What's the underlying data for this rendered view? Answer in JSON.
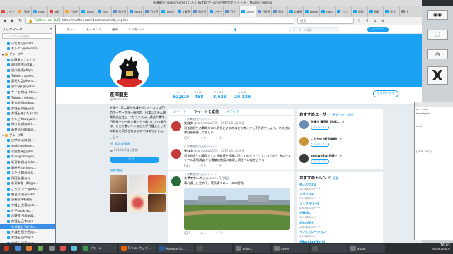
{
  "window": {
    "title": "茶澤龍史(@docmemo) さん / Twitterからの@会者指定ツイート - Mozilla Firefox"
  },
  "tabs": [
    {
      "label": "ツイー",
      "color": "#e24f3a"
    },
    {
      "label": "「仮名元",
      "color": "#f2a33a"
    },
    {
      "label": "Blog",
      "color": "#3ca4e6"
    },
    {
      "label": "無料",
      "color": "#e6363a"
    },
    {
      "label": "「仮名元",
      "color": "#f2a33a"
    },
    {
      "label": "Twitter",
      "color": "#1da1f2"
    },
    {
      "label": "Twitt",
      "color": "#1da1f2"
    },
    {
      "label": "石井元",
      "color": "#5a8ad6"
    },
    {
      "label": "Twitter",
      "color": "#1da1f2"
    },
    {
      "label": "石井元",
      "color": "#5a8ad6"
    },
    {
      "label": "Twitter",
      "color": "#1da1f2"
    },
    {
      "label": "IT業界",
      "color": "#1da1f2"
    },
    {
      "label": "石井元",
      "color": "#5a8ad6"
    },
    {
      "label": "ツイート",
      "color": "#1da1f2"
    },
    {
      "label": "石井",
      "color": "#5a8ad6"
    },
    {
      "label": "Twitter",
      "color": "#1da1f2"
    },
    {
      "label": "石井元",
      "color": "#5a8ad6"
    },
    {
      "label": "石井",
      "color": "#5a8ad6"
    },
    {
      "label": "IT業界",
      "color": "#1da1f2"
    },
    {
      "label": "Home",
      "color": "#1da1f2"
    },
    {
      "label": "Home",
      "color": "#1da1f2"
    },
    {
      "label": "せい",
      "color": "#1da1f2"
    },
    {
      "label": "移動",
      "color": "#1da1f2"
    },
    {
      "label": "移動",
      "color": "#1da1f2"
    },
    {
      "label": "中学",
      "color": "#1da1f2"
    },
    {
      "label": "宇",
      "color": "#888888"
    }
  ],
  "navbar": {
    "url": "https://twitter.com/docmemo/with_replies",
    "site_label": "Twitter, Inc. [US]",
    "search_placeholder": "検索"
  },
  "sidebar": {
    "title": "ブックマーク",
    "search_placeholder": "ブックマークを検索",
    "items": [
      {
        "label": "小坂克司@niste…",
        "indent": 1,
        "color": "#1da1f2"
      },
      {
        "label": "モトケン@moomo…",
        "indent": 1,
        "color": "#1da1f2"
      },
      {
        "label": "グループA",
        "indent": 0,
        "color": "#e4b83c",
        "folder": true
      },
      {
        "label": "佐藤勇ノブレナグ",
        "indent": 1,
        "color": "#1da1f2"
      },
      {
        "label": "四国総合法律事…",
        "indent": 1,
        "color": "#1da1f2"
      },
      {
        "label": "福川雅晴@Kiyo…",
        "indent": 1,
        "color": "#1da1f2"
      },
      {
        "label": "Twitter / spees…",
        "indent": 1,
        "color": "#1da1f2"
      },
      {
        "label": "悪元大臣@Kona…",
        "indent": 1,
        "color": "#1da1f2"
      },
      {
        "label": "黒木 亮(@ryokur…",
        "indent": 1,
        "color": "#1da1f2"
      },
      {
        "label": "サイモ木(@Hideo…",
        "indent": 1,
        "color": "#1da1f2"
      },
      {
        "label": "Twitter / oitmec…",
        "indent": 1,
        "color": "#1da1f2"
      },
      {
        "label": "東方総務(@dna…",
        "indent": 1,
        "color": "#1da1f2"
      },
      {
        "label": "弁護士 村田元(@…",
        "indent": 1,
        "color": "#1da1f2"
      },
      {
        "label": "弁護士あきたまいり…",
        "indent": 1,
        "color": "#1da1f2"
      },
      {
        "label": "ちもど Kobayash…",
        "indent": 1,
        "color": "#1da1f2"
      },
      {
        "label": "緑川玄朗(@aki…",
        "indent": 1,
        "color": "#1da1f2"
      },
      {
        "label": "藤井 忍(@hibar…",
        "indent": 1,
        "color": "#1da1f2"
      },
      {
        "label": "グループB",
        "indent": 0,
        "color": "#e4b83c",
        "folder": true
      },
      {
        "label": "□ポ川(@は治)…",
        "indent": 1,
        "color": "#1da1f2"
      },
      {
        "label": "yndy(@aiko@…",
        "indent": 1,
        "color": "#1da1f2"
      },
      {
        "label": "公安委員会@Ro…",
        "indent": 1,
        "color": "#1da1f2"
      },
      {
        "label": "片平(@anonyen…",
        "indent": 1,
        "color": "#1da1f2"
      },
      {
        "label": "新東本部(@Suke…",
        "indent": 1,
        "color": "#1da1f2"
      },
      {
        "label": "最新元(@chanc…",
        "indent": 1,
        "color": "#1da1f2"
      },
      {
        "label": "スデ日本(@tiks…",
        "indent": 1,
        "color": "#1da1f2"
      },
      {
        "label": "四国金融(@sy…",
        "indent": 1,
        "color": "#1da1f2"
      },
      {
        "label": "新東本郷一郎(@s…",
        "indent": 1,
        "color": "#1da1f2"
      },
      {
        "label": "こちら(ホー@oiko…",
        "indent": 1,
        "color": "#1da1f2"
      },
      {
        "label": "朝日文化(@naka…",
        "indent": 1,
        "color": "#1da1f2"
      },
      {
        "label": "酒巻法律事務所…",
        "indent": 1,
        "color": "#1da1f2"
      },
      {
        "label": "弁護士 大濱(@oi…",
        "indent": 1,
        "color": "#1da1f2"
      },
      {
        "label": "片平(@aknoo…",
        "indent": 1,
        "color": "#1da1f2"
      },
      {
        "label": "永野修己(@Sug…",
        "indent": 1,
        "color": "#1da1f2"
      },
      {
        "label": "弁護士 正木(@a…",
        "indent": 1,
        "color": "#1da1f2"
      },
      {
        "label": "茶澤龍史 Twi-Da…",
        "indent": 1,
        "color": "#1da1f2",
        "selected": true
      },
      {
        "label": "弁護士 石井元(@…",
        "indent": 1,
        "color": "#1da1f2"
      },
      {
        "label": "弁護士 山口(@1…",
        "indent": 1,
        "color": "#1da1f2"
      },
      {
        "label": "弁護士 近藤(@sr…",
        "indent": 1,
        "color": "#1da1f2"
      }
    ]
  },
  "twitter_nav": {
    "home": "ホーム",
    "moments": "モーメント",
    "notifications": "通知",
    "messages": "メッセージ",
    "search_placeholder": "キーワード検索",
    "tweet_button": "ツイート"
  },
  "stats": [
    {
      "label": "ツイート",
      "value": "62,529"
    },
    {
      "label": "フォロー",
      "value": "458"
    },
    {
      "label": "フォロワー",
      "value": "3,629"
    },
    {
      "label": "いいね",
      "value": "26,229"
    }
  ],
  "follow_button": "フォローする",
  "profile": {
    "name": "茶澤龍史",
    "handle": "@docmemo",
    "bio": "弁護士 (第二東京弁護士会) アイコンはTVのアーサーカラー市内の「日本システム開発株式会社」。トピックスは、訴訟や事件、行政書士の一般企業とやり取りしたい場合は、ここで書いていることが弁護士としての発言と同視されるものではありません。",
    "location": "日本",
    "link": "開設者情報",
    "joined": "2010年6月に登録",
    "tweet_button": "ツイート",
    "photos_label": "画像/動画"
  },
  "timeline": {
    "tabs": [
      "ツイート",
      "ツイートと返信",
      "メディア"
    ],
    "tweets": [
      {
        "context": "茶澤龍史さんがリツイート",
        "name": "矢口少",
        "handle": "@tomochanCRS・2017年11月30日",
        "text": "司法修習生の費用を本人負担にするのはどう考えても不合理でしょう。せめて給費制を維持して欲しい。",
        "reply": "3",
        "retweet": "8",
        "like": "11"
      },
      {
        "context": "茶澤龍史さんがリツイート",
        "name": "矢口少",
        "handle": "@tomochanCRS・2017年11月30日",
        "text": "司法修習生の費用として経験値を投資に回してみたらどうでしょうか？ #ロースクール実態調査 #法曹養成制度の崩壊と再生への道をさぐる",
        "reply": "2",
        "retweet": "6",
        "like": "9"
      },
      {
        "context": "茶澤龍史さんがリツイート",
        "name": "スポエアック",
        "handle": "@spoeac・2月8日",
        "text": "晴れ渡った空の下、競馬場でのレースの観戦。",
        "reply": "1",
        "retweet": "4",
        "like": "12"
      }
    ]
  },
  "who_to_follow": {
    "title": "おすすめユーザー",
    "links": "更新・すべて表示",
    "users": [
      {
        "name": "弁護士 清田照 (Yoji…",
        "color": "#6a8bb5"
      },
      {
        "name": "これらの (経営論者)",
        "color": "#c9953a"
      },
      {
        "name": "anonymity 弁護士",
        "color": "#3a3a3a"
      }
    ],
    "follow_label": "フォローする"
  },
  "trends": {
    "title": "おすすめトレンド",
    "link": "変更",
    "items": [
      {
        "name": "#ノバウスキ",
        "count": "1,234件のツイート"
      },
      {
        "name": "ノバウスキ",
        "count": "2,511件のツイート"
      },
      {
        "name": "フェブラリーS",
        "count": "4,567件のツイート"
      },
      {
        "name": "中野JSL",
        "count": "3,210件のツイート"
      },
      {
        "name": "#山口智士",
        "count": "1,987件のツイート"
      },
      {
        "name": "インスピレーション",
        "count": "2,222件のツイート"
      },
      {
        "name": "#BackingWorld",
        "count": "5,123件のツイート"
      },
      {
        "name": "北海道旅客鉄道株式会社",
        "count": "1,111件のツイート"
      },
      {
        "name": "#フェブラリーステークス",
        "count": "6,789件のツイート"
      }
    ]
  },
  "desktop": {
    "overlay_lines": [
      "ctrl+Ines",
      "lemdep/dok",
      "",
      "",
      "rent.",
      "",
      "",
      "",
      "",
      "",
      "(2016 2013)"
    ]
  },
  "taskbar": {
    "items": [
      {
        "label": "",
        "color": "#c23b22"
      },
      {
        "label": "",
        "color": "#4a8ad4"
      },
      {
        "label": "",
        "color": "#e07a2f"
      },
      {
        "label": "",
        "color": "#6aa84f"
      },
      {
        "label": "",
        "color": "#888888"
      },
      {
        "label": "",
        "color": "#d9534f"
      },
      {
        "label": "",
        "color": "#5bc0de"
      },
      {
        "label": "グラーム",
        "color": "#3a9a4a",
        "task": true
      },
      {
        "label": "Firefox ウェブ…",
        "color": "#e66000",
        "task": true
      },
      {
        "label": "Konsole Scr…",
        "color": "#2b5797",
        "task": true
      },
      {
        "label": "",
        "color": "#555555",
        "task": true
      },
      {
        "label": "xclock",
        "color": "#777777",
        "task": true
      },
      {
        "label": "xeyes",
        "color": "#777777",
        "task": true
      },
      {
        "label": "",
        "color": "#555555",
        "task": true
      },
      {
        "label": "xlogo",
        "color": "#777777",
        "task": true
      }
    ],
    "time": "16:03",
    "date": "2018年2月18日"
  }
}
